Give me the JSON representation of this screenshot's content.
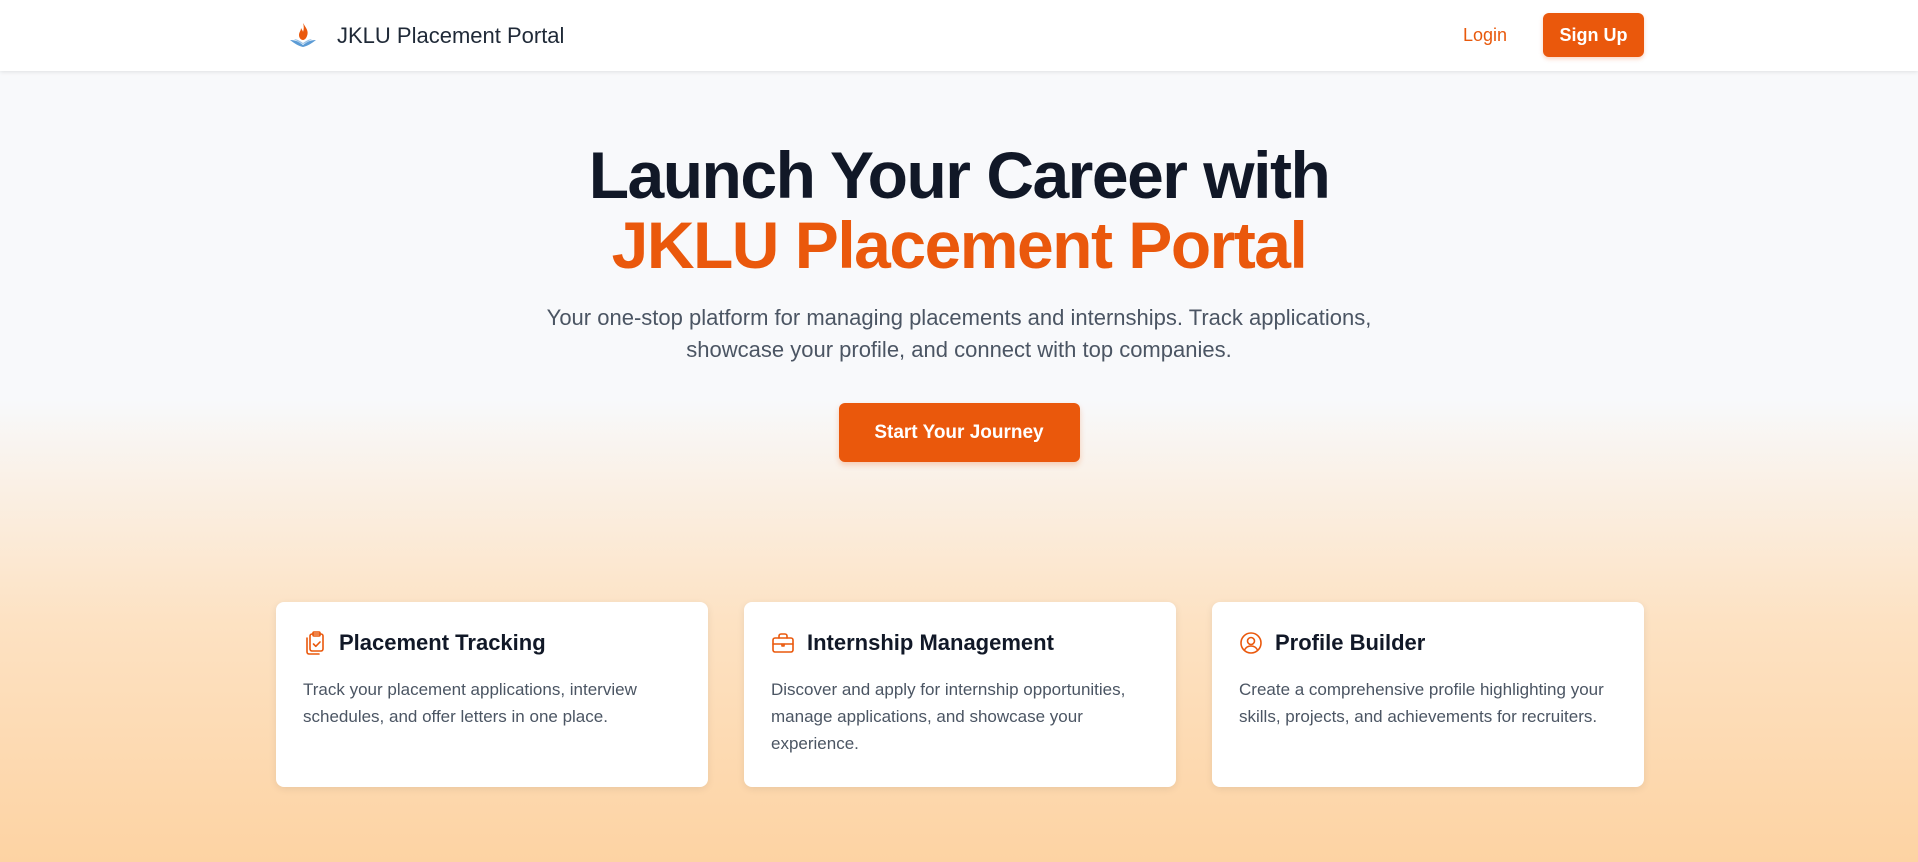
{
  "header": {
    "brand_title": "JKLU Placement Portal",
    "logo_icon": "flame-logo-icon",
    "login_label": "Login",
    "signup_label": "Sign Up"
  },
  "hero": {
    "title_line1": "Launch Your Career with",
    "title_line2": "JKLU Placement Portal",
    "subtitle": "Your one-stop platform for managing placements and internships. Track applications, showcase your profile, and connect with top companies.",
    "cta_label": "Start Your Journey"
  },
  "features": [
    {
      "icon": "clipboard-check-icon",
      "title": "Placement Tracking",
      "description": "Track your placement applications, interview schedules, and offer letters in one place."
    },
    {
      "icon": "briefcase-icon",
      "title": "Internship Management",
      "description": "Discover and apply for internship opportunities, manage applications, and showcase your experience."
    },
    {
      "icon": "user-circle-icon",
      "title": "Profile Builder",
      "description": "Create a comprehensive profile highlighting your skills, projects, and achievements for recruiters."
    }
  ],
  "colors": {
    "accent": "#ea580c",
    "heading": "#111827",
    "body_text": "#4b5563",
    "background_top": "#f8f9fb",
    "background_bottom": "#fdd3a3"
  }
}
